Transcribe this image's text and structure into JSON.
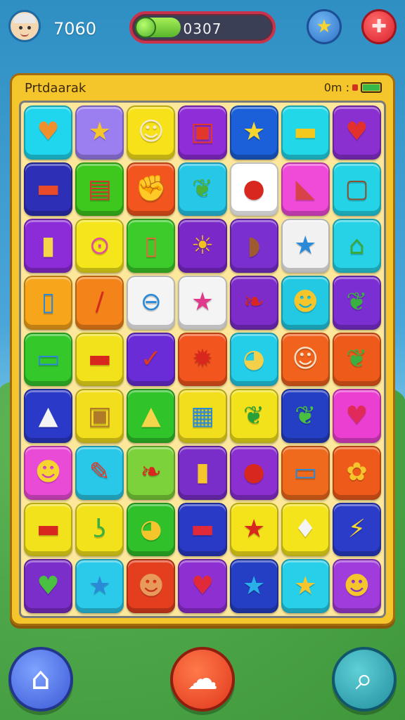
{
  "top_bar": {
    "coins": "7060",
    "progress_text": "0307",
    "progress_fraction": 0.18
  },
  "board": {
    "title": "Prtdaarak",
    "info": "0m :"
  },
  "tiles": [
    [
      "orange-heart-icon",
      "star-icon",
      "smiley-face-icon",
      "gift-box-icon",
      "star-icon",
      "folder-icon",
      "heart-icon"
    ],
    [
      "cake-slice-icon",
      "shop-icon",
      "boxing-glove-icon",
      "leaf-icon",
      "red-balloon-icon",
      "watermelon-slice-icon",
      "camera-icon"
    ],
    [
      "sticky-note-icon",
      "lollipop-icon",
      "fire-hydrant-icon",
      "sun-icon",
      "bandage-icon",
      "star-icon",
      "robot-icon"
    ],
    [
      "bottle-icon",
      "hammer-icon",
      "spinning-top-icon",
      "star-icon",
      "apple-icon",
      "face-icon",
      "leaf-icon"
    ],
    [
      "bucket-icon",
      "toolbox-icon",
      "checkmark-envelope-icon",
      "gear-icon",
      "lemon-face-icon",
      "smiley-face-icon",
      "leaf-icon"
    ],
    [
      "bottle-icon",
      "radio-icon",
      "arrow-up-icon",
      "calendar-icon",
      "leaf-icon",
      "leaf-icon",
      "heart-icon"
    ],
    [
      "cat-face-icon",
      "pencil-icon",
      "leaf-icon",
      "battery-icon",
      "red-ball-icon",
      "truck-icon",
      "flower-face-icon"
    ],
    [
      "truck-icon",
      "hook-icon",
      "lemon-icon",
      "card-icon",
      "star-icon",
      "ice-cream-icon",
      "lightning-icon"
    ],
    [
      "heart-icon",
      "blue-star-icon",
      "monkey-face-icon",
      "heart-icon",
      "star-icon",
      "star-icon",
      "bear-face-icon"
    ]
  ],
  "tile_colors": [
    [
      "#1fd6ee",
      "#9b7ff0",
      "#f7e21a",
      "#8f2dd8",
      "#1b5fd9",
      "#22d7e8",
      "#8a2fd0"
    ],
    [
      "#2d2fb6",
      "#3ec71d",
      "#f2561e",
      "#27c7e8",
      "#ffffff",
      "#f04ad8",
      "#24d4e6"
    ],
    [
      "#8c2bd8",
      "#f4e61a",
      "#3bcb2a",
      "#7b28c9",
      "#7a2fcf",
      "#f1f1f1",
      "#27d2e6"
    ],
    [
      "#f7a51a",
      "#f4831a",
      "#f4f4f4",
      "#f4f4f4",
      "#7d2cc9",
      "#23c9e3",
      "#7b2fd3"
    ],
    [
      "#34c82a",
      "#f2e21c",
      "#6a2cd6",
      "#f2561e",
      "#24cde8",
      "#f1621c",
      "#ee5a1a"
    ],
    [
      "#2b39c8",
      "#f2de1c",
      "#30c32a",
      "#f2de1c",
      "#f2e21c",
      "#243fc4",
      "#ea3fd0"
    ],
    [
      "#ea4bd6",
      "#29c8e8",
      "#7bd23a",
      "#7a2ec9",
      "#8b2fd0",
      "#ef6a1c",
      "#ee5a1a"
    ],
    [
      "#f2e21c",
      "#f2e21c",
      "#2fc02a",
      "#283ac6",
      "#f4e21a",
      "#f4e41c",
      "#2a3cc8"
    ],
    [
      "#7b2ec9",
      "#2ccaea",
      "#e33f1f",
      "#8e2fd2",
      "#243fc4",
      "#27cfe8",
      "#a03cdc"
    ]
  ],
  "tile_glyphs": [
    [
      "♥",
      "★",
      "☺",
      "▣",
      "★",
      "▬",
      "♥"
    ],
    [
      "▬",
      "▤",
      "✊",
      "❦",
      "●",
      "◣",
      "▢"
    ],
    [
      "▮",
      "⊙",
      "▯",
      "☀",
      "◗",
      "★",
      "⌂"
    ],
    [
      "▯",
      "∕",
      "⊖",
      "★",
      "❧",
      "☻",
      "❦"
    ],
    [
      "▭",
      "▬",
      "✓",
      "✹",
      "◕",
      "☺",
      "❦"
    ],
    [
      "▲",
      "▣",
      "▲",
      "▦",
      "❦",
      "❦",
      "♥"
    ],
    [
      "☻",
      "✎",
      "❧",
      "▮",
      "●",
      "▭",
      "✿"
    ],
    [
      "▬",
      "ʖ",
      "◕",
      "▬",
      "★",
      "♦",
      "⚡"
    ],
    [
      "♥",
      "★",
      "☻",
      "♥",
      "★",
      "★",
      "☻"
    ]
  ],
  "glyph_colors": [
    [
      "#f0902c",
      "#f4c62c",
      "#f7e8d0",
      "#e2382c",
      "#f5d52e",
      "#f4c81c",
      "#e2302c"
    ],
    [
      "#e84a2a",
      "#d23a2a",
      "#d23a1a",
      "#4ab03a",
      "#d7271e",
      "#d8424a",
      "#8a5030"
    ],
    [
      "#f5d54a",
      "#e24aa0",
      "#e06a3a",
      "#f2c01c",
      "#a05a30",
      "#2a8ad8",
      "#3aa83a"
    ],
    [
      "#2a8ad8",
      "#d7271e",
      "#2a8ad8",
      "#e03a8a",
      "#d7271e",
      "#f5c52c",
      "#3ab040"
    ],
    [
      "#2a8ad8",
      "#d7271e",
      "#e03a1e",
      "#d7271e",
      "#f4d04a",
      "#f4e2c8",
      "#3ab040"
    ],
    [
      "#f4f4f4",
      "#b07a2a",
      "#f5d54a",
      "#2a8ad8",
      "#2aa038",
      "#4ac040",
      "#e02a5a"
    ],
    [
      "#f5d52e",
      "#e03a2a",
      "#d7271e",
      "#f5c52c",
      "#d7271e",
      "#2a8ad8",
      "#f5c52c"
    ],
    [
      "#d7271e",
      "#3ab040",
      "#f5c52c",
      "#e02a3a",
      "#d7271e",
      "#f4f4f4",
      "#f5d52e"
    ],
    [
      "#4ac040",
      "#2a8ad8",
      "#e89a5a",
      "#e02a3a",
      "#2ab0e8",
      "#f5c52c",
      "#f5c52c"
    ]
  ],
  "nav": {
    "home_icon": "home-icon",
    "chat_icon": "chat-bubble-icon",
    "search_icon": "search-icon"
  }
}
